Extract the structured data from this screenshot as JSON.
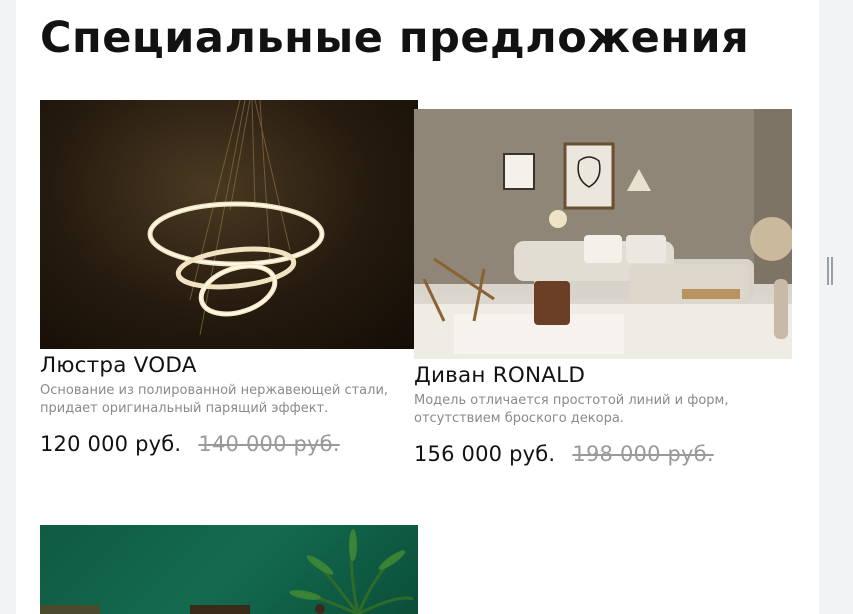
{
  "page": {
    "title": "Специальные предложения"
  },
  "products": [
    {
      "name": "Люстра VODA",
      "description": "Основание из полированной нержавеющей стали, придает оригинальный парящий эффект.",
      "price": "120 000 руб.",
      "old_price": "140 000 руб."
    },
    {
      "name": "Диван RONALD",
      "description": "Модель отличается простотой линий и форм, отсутствием броского декора.",
      "price": "156 000 руб.",
      "old_price": "198 000 руб."
    }
  ],
  "colors": {
    "background": "#f2f3f5",
    "panel": "#ffffff",
    "text": "#121212",
    "muted": "#8a8a8a",
    "old_price": "#9a9a9a"
  }
}
